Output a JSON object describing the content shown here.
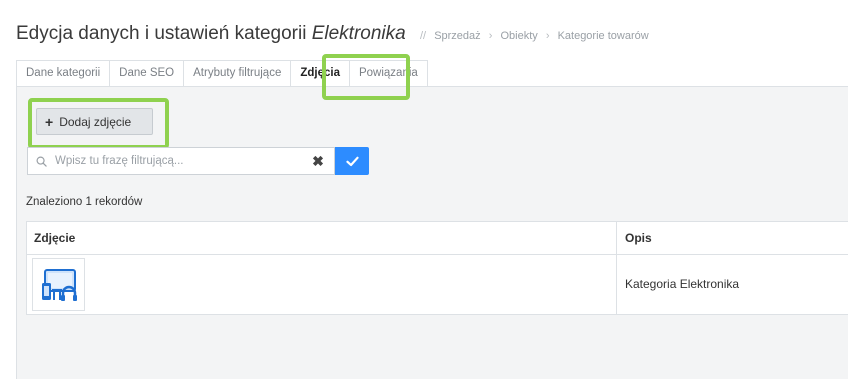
{
  "header": {
    "title_prefix": "Edycja danych i ustawień kategorii",
    "title_emphasis": "Elektronika",
    "breadcrumb": [
      "Sprzedaż",
      "Obiekty",
      "Kategorie towarów"
    ]
  },
  "tabs": [
    {
      "label": "Dane kategorii"
    },
    {
      "label": "Dane SEO"
    },
    {
      "label": "Atrybuty filtrujące"
    },
    {
      "label": "Zdjęcia"
    },
    {
      "label": "Powiązania"
    }
  ],
  "toolbar": {
    "add_label": "Dodaj zdjęcie"
  },
  "search": {
    "placeholder": "Wpisz tu frazę filtrującą...",
    "value": ""
  },
  "results": {
    "found_text": "Znaleziono 1 rekordów"
  },
  "table": {
    "columns": [
      "Zdjęcie",
      "Opis"
    ],
    "rows": [
      {
        "description": "Kategoria Elektronika",
        "image_icon": "electronics-icon"
      }
    ]
  },
  "colors": {
    "accent": "#2d8cff",
    "highlight": "#8fd14f",
    "panel_bg": "#f3f4f5"
  }
}
